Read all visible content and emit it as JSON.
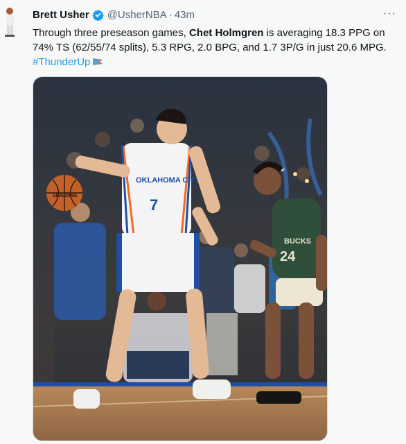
{
  "tweet": {
    "author_name": "Brett Usher",
    "handle": "@UsherNBA",
    "separator": "·",
    "time": "43m",
    "more_label": "···",
    "text_before": "Through three preseason games, ",
    "text_bold": "Chet Holmgren",
    "text_after": " is averaging 18.3 PPG on 74% TS (62/55/74 splits), 5.3 RPG, 2.0 BPG, and 1.7 3P/G in just 20.6 MPG.",
    "hashtag": "#ThunderUp",
    "hashtag_icon": "thunder-flag-icon",
    "verified_icon": "verified-badge-icon"
  },
  "photo": {
    "jersey_front_text": "OKLAHOMA CITY",
    "jersey_number": "7",
    "defender_number": "24",
    "defender_jersey_text": "BUCKS",
    "ball_text": "SPALDING"
  },
  "colors": {
    "link": "#1d9bf0",
    "verified": "#1d9bf0",
    "secondary_text": "#536471",
    "thunder_blue": "#1f4ea3",
    "thunder_orange": "#ef6a22",
    "bucks_green": "#2f4f3a"
  }
}
